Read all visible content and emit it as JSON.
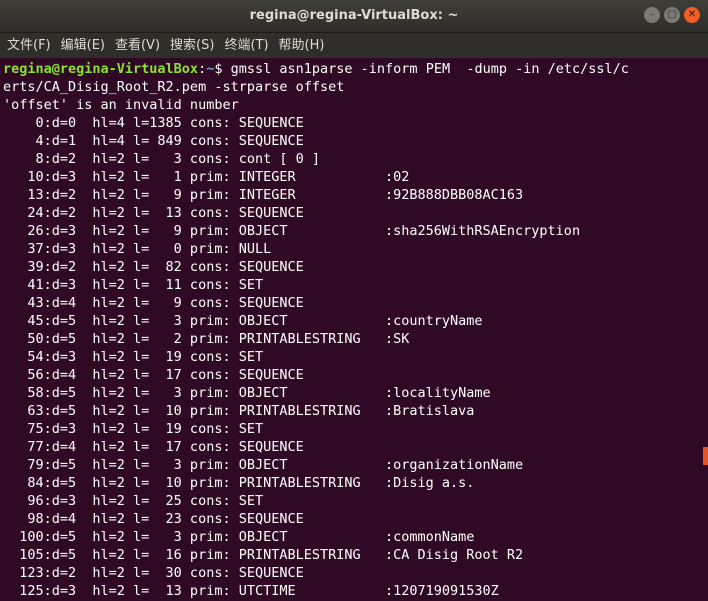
{
  "window": {
    "title": "regina@regina-VirtualBox: ~",
    "minimize": "–",
    "maximize": "▢",
    "close": "✕"
  },
  "menu": [
    "文件(F)",
    "编辑(E)",
    "查看(V)",
    "搜索(S)",
    "终端(T)",
    "帮助(H)"
  ],
  "terminal": {
    "prompt_user": "regina@regina-VirtualBox",
    "prompt_sep": ":",
    "prompt_path": "~",
    "prompt_symbol": "$ ",
    "command_line1": "gmssl asn1parse -inform PEM  -dump -in /etc/ssl/c",
    "command_line2": "erts/CA_Disig_Root_R2.pem -strparse offset",
    "output": [
      "'offset' is an invalid number",
      "    0:d=0  hl=4 l=1385 cons: SEQUENCE",
      "    4:d=1  hl=4 l= 849 cons: SEQUENCE",
      "    8:d=2  hl=2 l=   3 cons: cont [ 0 ]",
      "   10:d=3  hl=2 l=   1 prim: INTEGER           :02",
      "   13:d=2  hl=2 l=   9 prim: INTEGER           :92B888DBB08AC163",
      "   24:d=2  hl=2 l=  13 cons: SEQUENCE",
      "   26:d=3  hl=2 l=   9 prim: OBJECT            :sha256WithRSAEncryption",
      "   37:d=3  hl=2 l=   0 prim: NULL",
      "   39:d=2  hl=2 l=  82 cons: SEQUENCE",
      "   41:d=3  hl=2 l=  11 cons: SET",
      "   43:d=4  hl=2 l=   9 cons: SEQUENCE",
      "   45:d=5  hl=2 l=   3 prim: OBJECT            :countryName",
      "   50:d=5  hl=2 l=   2 prim: PRINTABLESTRING   :SK",
      "   54:d=3  hl=2 l=  19 cons: SET",
      "   56:d=4  hl=2 l=  17 cons: SEQUENCE",
      "   58:d=5  hl=2 l=   3 prim: OBJECT            :localityName",
      "   63:d=5  hl=2 l=  10 prim: PRINTABLESTRING   :Bratislava",
      "   75:d=3  hl=2 l=  19 cons: SET",
      "   77:d=4  hl=2 l=  17 cons: SEQUENCE",
      "   79:d=5  hl=2 l=   3 prim: OBJECT            :organizationName",
      "   84:d=5  hl=2 l=  10 prim: PRINTABLESTRING   :Disig a.s.",
      "   96:d=3  hl=2 l=  25 cons: SET",
      "   98:d=4  hl=2 l=  23 cons: SEQUENCE",
      "  100:d=5  hl=2 l=   3 prim: OBJECT            :commonName",
      "  105:d=5  hl=2 l=  16 prim: PRINTABLESTRING   :CA Disig Root R2",
      "  123:d=2  hl=2 l=  30 cons: SEQUENCE",
      "  125:d=3  hl=2 l=  13 prim: UTCTIME           :120719091530Z"
    ]
  },
  "colors": {
    "terminal_bg": "#300a24",
    "prompt_user": "#8ae234",
    "prompt_path": "#729fcf",
    "text": "#ffffff",
    "close_button": "#f15d22"
  }
}
